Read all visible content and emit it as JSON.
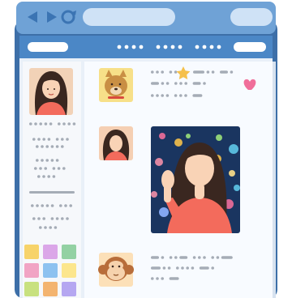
{
  "palette": {
    "frame_outer": "#3d6fa8",
    "frame_inner": "#e9f0f8",
    "topbar": "#6fa2d6",
    "urlbar": "#cfe2f6",
    "nav_icons": "#3b74b3",
    "header_band": "#4b87c6",
    "pill": "#ffffff",
    "sidebar_bg": "#f6f8fb",
    "content_bg": "#f8fbff",
    "text_stub": "#a5acb6",
    "star": "#f5c04a",
    "heart": "#f06e9a",
    "post_bg": "#1a3560",
    "woman_shirt": "#f36b5c",
    "woman_hair": "#3a2720",
    "skin": "#f9d3b6",
    "dog": "#c98f44",
    "dog_bg": "#f7e089",
    "monkey": "#b86d3a",
    "monkey_bg": "#fce0b8",
    "profile_bg": "#f2d2b7",
    "tile_colors": [
      "#f7d36a",
      "#dba6e8",
      "#93d1a3",
      "#f1a4c4",
      "#8dc2f0",
      "#fce68d",
      "#c8e17f",
      "#f3b470",
      "#b5a7f1"
    ],
    "bokeh_colors": [
      "#f06e9a",
      "#f5c04a",
      "#9be07a",
      "#5ec7e8",
      "#f38fa8",
      "#ffe08a",
      "#8fb3ff"
    ]
  },
  "icons": [
    "back-arrow-icon",
    "forward-arrow-icon",
    "reload-icon",
    "star-icon",
    "heart-icon"
  ]
}
